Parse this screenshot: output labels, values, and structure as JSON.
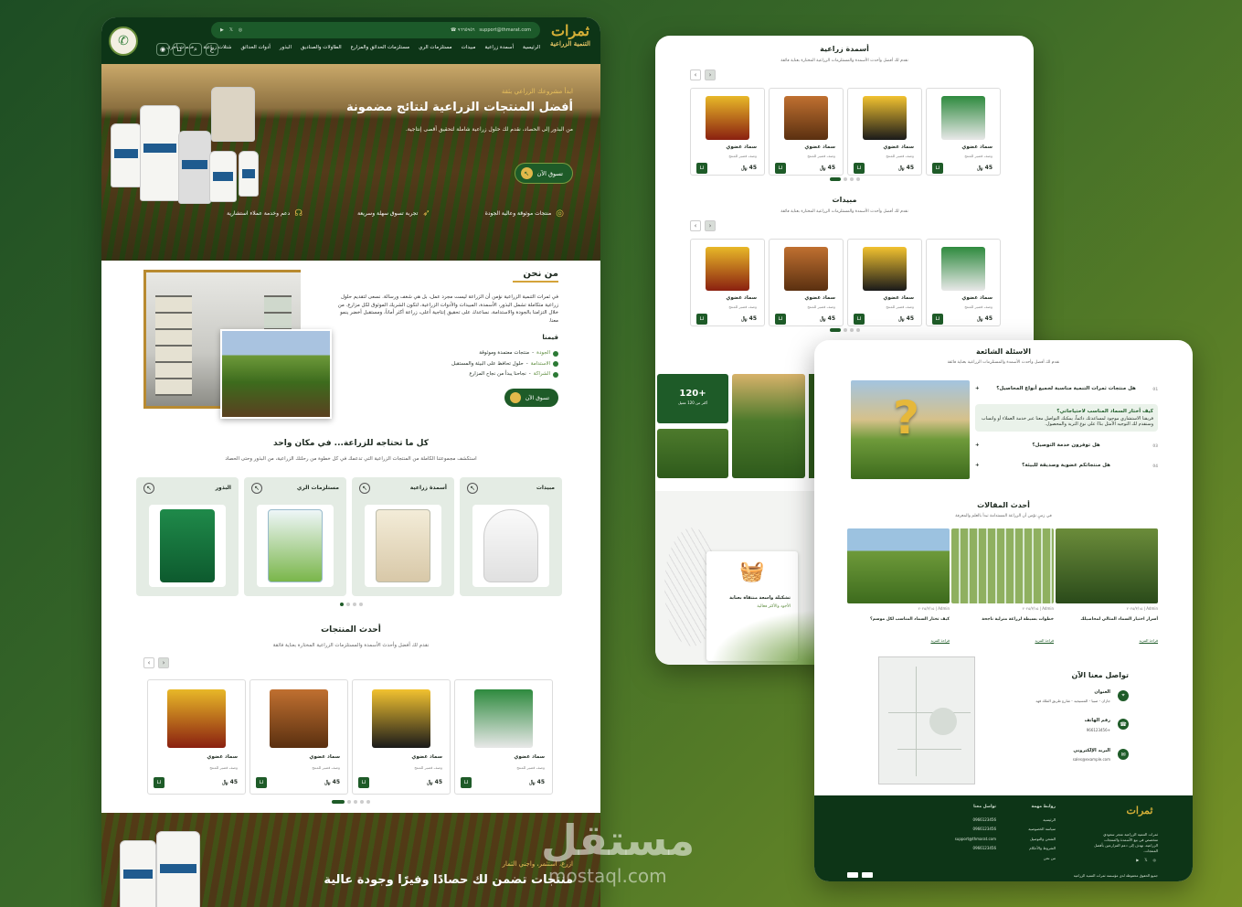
{
  "main": {
    "header": {
      "logo_title": "ثمرات",
      "logo_sub": "التنمية الزراعية",
      "email": "support@thmarat.com",
      "phone": "٩٦٦٥٩٥٦",
      "nav": [
        "الرئيسية",
        "أسمدة زراعية",
        "مبيدات",
        "مستلزمات الري",
        "مستلزمات الحدائق والمزارع",
        "الطاولات والصناديق",
        "البذور",
        "أدوات الحدائق",
        "شتلات زراعية",
        "خدمات أخرى"
      ],
      "lang": "ع"
    },
    "hero": {
      "kicker": "ابدأ مشروعك الزراعي بثقة",
      "title": "أفضل المنتجات الزراعية لنتائج مضمونة",
      "subtitle": "من البذور إلى الحصاد، نقدم لك حلول زراعية شاملة لتحقيق أقصى إنتاجية.",
      "button": "تسوق الآن",
      "features": [
        "منتجات موثوقة وعالية الجودة",
        "تجربة تسوق سهلة وسريعة",
        "دعم وخدمة عملاء استشارية"
      ]
    },
    "about": {
      "title": "من نحن",
      "text": "في ثمرات التنمية الزراعية نؤمن أن الزراعة ليست مجرد عمل، بل هي شغف ورسالة. نسعى لتقديم حلول زراعية متكاملة تشمل البذور، الأسمدة، المبيدات والأدوات الزراعية، لتكون الشريك الموثوق لكل مزارع. من خلال التزامنا بالجودة والاستدامة، نساعدك على تحقيق إنتاجية أعلى، زراعة أكثر أماناً، ومستقبل أخضر ينمو معنا.",
      "values_title": "قيمنا",
      "values": [
        {
          "k": "الجودة",
          "v": "منتجات معتمدة وموثوقة"
        },
        {
          "k": "الاستدامة",
          "v": "حلول تحافظ على البيئة والمستقبل"
        },
        {
          "k": "الشراكة",
          "v": "نجاحنا يبدأ من نجاح المزارع"
        }
      ],
      "button": "تسوق الآن"
    },
    "categories": {
      "title": "كل ما تحتاجه للزراعة... في مكان واحد",
      "subtitle": "استكشف مجموعتنا الكاملة من المنتجات الزراعية التي تدعمك في كل خطوة من رحلتك الزراعية، من البذور وحتى الحصاد",
      "items": [
        "مبيدات",
        "أسمدة زراعية",
        "مستلزمات الري",
        "البذور"
      ]
    },
    "latest": {
      "title": "أحدث المنتجات",
      "subtitle": "نقدم لك أفضل وأحدث الأسمدة والمستلزمات الزراعية المختارة بعناية فائقة",
      "product_name": "سماد عضوي",
      "product_desc": "وصف قصير للمنتج",
      "price": "45"
    },
    "hero2": {
      "kicker": "ازرع، استثمر، واجني الثمار",
      "title": "منتجات تضمن لك حصادًا وفيرًا وجودة عالية"
    }
  },
  "panel_b": {
    "fert_title": "أسمدة زراعية",
    "fert_sub": "نقدم لك أفضل وأحدث الأسمدة والمستلزمات الزراعية المختارة بعناية فائقة",
    "pest_title": "مبيدات",
    "pest_sub": "نقدم لك أفضل وأحدث الأسمدة والمستلزمات الزراعية المختارة بعناية فائقة",
    "stat_value": "+120",
    "stat_label": "أكثر من 120 عميل",
    "card_title": "تشكيلة واسعة منتقاة بعناية",
    "card_sub": "الأجود والأكثر فعالية"
  },
  "panel_c": {
    "faq_title": "الاسئلة الشائعة",
    "faq_sub": "نقدم لك أفضل وأحدث الأسمدة والمستلزمات الزراعية بعناية فائقة",
    "faqs": [
      {
        "n": "01",
        "q": "هل منتجات ثمرات التنمية مناسبة لجميع أنواع المحاصيل؟"
      },
      {
        "n": "02",
        "q": "كيف أختار السماد المناسب لاحتياجاتي؟",
        "a": "فريقنا الاستشاري موجود لمساعدتك دائماً، يمكنك التواصل معنا عبر خدمة العملاء أو واتساب وسنقدم لك التوجيه الأمثل بناءً على نوع التربة والمحصول."
      },
      {
        "n": "03",
        "q": "هل توفرون خدمة التوصيل؟"
      },
      {
        "n": "04",
        "q": "هل منتجاتكم عضوية وصديقة للبيئة؟"
      }
    ],
    "blog_title": "أحدث المقالات",
    "blog_sub": "في زمنٍ نؤمن أن الزراعة المستدامة تبدأ بالعلم والمعرفة",
    "articles": [
      {
        "meta": "Admin | ٢٠٢٥/٣/١٥",
        "title": "أسرار اختيار السماد المثالي لمحاصيلك",
        "more": "قراءة المزيد"
      },
      {
        "meta": "Admin | ٢٠٢٥/٣/١٥",
        "title": "خطوات بسيطة لزراعة منزلية ناجحة",
        "more": "قراءة المزيد"
      },
      {
        "meta": "Admin | ٢٠٢٥/٣/١٥",
        "title": "كيف تختار السماد المناسب لكل موسم؟",
        "more": "قراءة المزيد"
      }
    ],
    "contact_title": "تواصل معنا الآن",
    "contact": [
      {
        "label": "العنوان",
        "value": "جازان - صبيا - المسيجيد - شارع طريق الملك فهد"
      },
      {
        "label": "رقم الهاتف",
        "value": "+966123456"
      },
      {
        "label": "البريد الإلكتروني",
        "value": "sales@example.com"
      }
    ],
    "footer": {
      "about": "ثمرات التنمية الزراعية متجر سعودي متخصص في بيع الأسمدة والمنتجات الزراعية، نهدف إلى دعم المزارعين بأفضل المنتجات.",
      "links_title": "روابط مهمة",
      "links": [
        "الرئيسية",
        "سياسة الخصوصية",
        "الشحن والتوصيل",
        "الشروط والأحكام",
        "من نحن"
      ],
      "contact_title": "تواصل معنا",
      "phones": [
        "0966123456",
        "0966123456",
        "support@thmarat.com",
        "0966123456"
      ],
      "copyright": "جميع الحقوق محفوظة لدى مؤسسة ثمرات التنمية الزراعية"
    }
  },
  "watermark": {
    "ar": "مستقل",
    "en": "mostaql.com"
  }
}
